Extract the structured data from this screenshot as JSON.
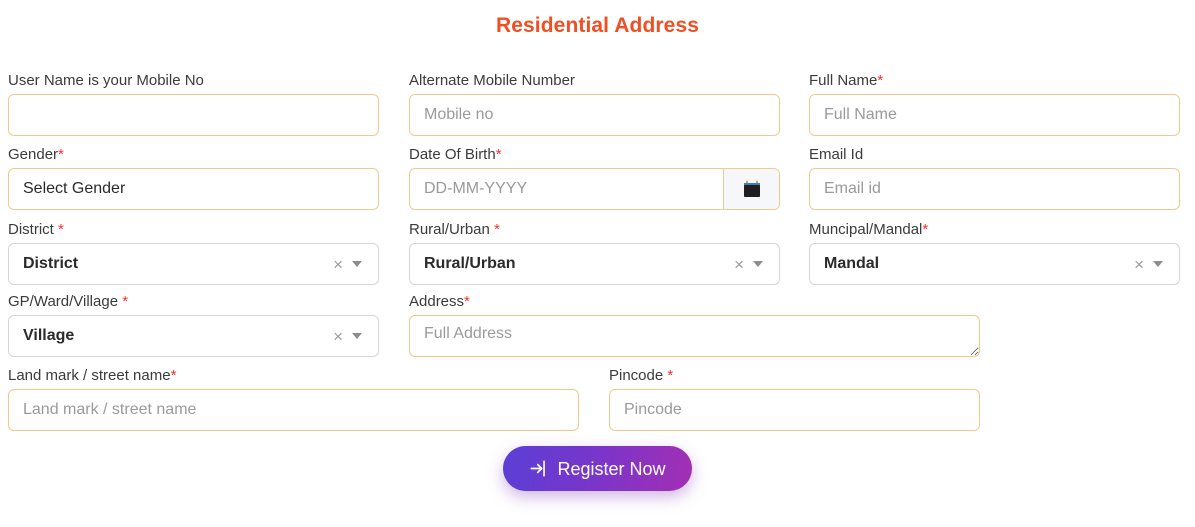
{
  "header": {
    "title": "Residential Address",
    "title_color": "#f04e23"
  },
  "theme": {
    "input_border": "#f3c98b",
    "select_border": "#d6d6d6",
    "required_marker": "*",
    "required_color": "#ff2d2d",
    "button_gradient_from": "#5b3fd6",
    "button_gradient_to": "#a32fb4"
  },
  "fields": {
    "username": {
      "label": "User Name is your Mobile No",
      "required": false,
      "placeholder": "",
      "value": ""
    },
    "alternate_mobile": {
      "label": "Alternate Mobile Number",
      "required": false,
      "placeholder": "Mobile no",
      "value": ""
    },
    "full_name": {
      "label": "Full Name",
      "required": true,
      "placeholder": "Full Name",
      "value": ""
    },
    "gender": {
      "label": "Gender",
      "required": true,
      "selected": "Select Gender"
    },
    "dob": {
      "label": "Date Of Birth",
      "required": true,
      "placeholder": "DD-MM-YYYY",
      "value": "",
      "calendar_icon": "calendar-icon"
    },
    "email": {
      "label": "Email Id",
      "required": false,
      "placeholder": "Email id",
      "value": ""
    },
    "district": {
      "label": "District ",
      "required": true,
      "selected": "District",
      "clear_glyph": "×"
    },
    "rural_urban": {
      "label": "Rural/Urban ",
      "required": true,
      "selected": "Rural/Urban",
      "clear_glyph": "×"
    },
    "mandal": {
      "label": "Muncipal/Mandal",
      "required": true,
      "selected": "Mandal",
      "clear_glyph": "×"
    },
    "village": {
      "label": "GP/Ward/Village ",
      "required": true,
      "selected": "Village",
      "clear_glyph": "×"
    },
    "address": {
      "label": "Address",
      "required": true,
      "placeholder": "Full Address",
      "value": ""
    },
    "landmark": {
      "label": "Land mark / street name",
      "required": true,
      "placeholder": "Land mark / street name",
      "value": ""
    },
    "pincode": {
      "label": "Pincode ",
      "required": true,
      "placeholder": "Pincode",
      "value": ""
    }
  },
  "submit": {
    "label": "Register Now",
    "icon": "sign-in-icon"
  }
}
